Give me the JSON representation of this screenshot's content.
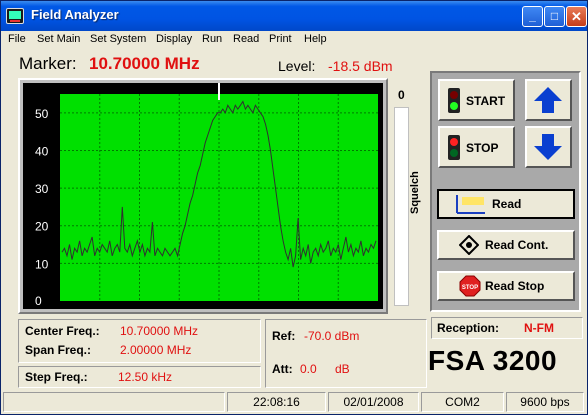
{
  "window": {
    "title": "Field Analyzer",
    "minimize": "_",
    "maximize": "□",
    "close": "✕"
  },
  "menu": [
    "File",
    "Set Main",
    "Set System",
    "Display",
    "Run",
    "Read",
    "Print",
    "Help"
  ],
  "marker": {
    "label": "Marker:",
    "value": "10.70000 MHz"
  },
  "level": {
    "label": "Level:",
    "value": "-18.5 dBm"
  },
  "graph": {
    "bg_color": "#00e000",
    "grid_color": "#007a00",
    "trace_color": "#303030",
    "y_ticks": [
      "50",
      "40",
      "30",
      "20",
      "10",
      "0"
    ],
    "y_range": [
      0,
      55
    ],
    "trace": [
      13,
      14,
      12,
      15,
      11,
      14,
      13,
      16,
      12,
      14,
      13,
      15,
      17,
      12,
      14,
      13,
      15,
      14,
      13,
      16,
      12,
      14,
      15,
      13,
      25,
      14,
      13,
      15,
      12,
      14,
      16,
      13,
      15,
      12,
      14,
      13,
      21,
      12,
      14,
      13,
      12,
      14,
      13,
      12,
      13,
      14,
      12,
      15,
      18,
      20,
      23,
      26,
      28,
      31,
      34,
      36,
      39,
      42,
      44,
      46,
      48,
      49,
      50,
      50,
      51,
      50,
      52,
      51,
      50,
      52,
      51,
      52,
      53,
      51,
      52,
      51,
      50,
      52,
      51,
      50,
      49,
      47,
      44,
      40,
      35,
      30,
      25,
      20,
      16,
      13,
      11,
      14,
      9,
      12,
      22,
      11,
      14,
      12,
      15,
      10,
      13,
      14,
      12,
      15,
      13,
      14,
      16,
      12,
      14,
      13,
      15,
      11,
      14,
      17,
      13,
      15,
      12,
      14,
      13,
      16,
      12,
      14,
      13,
      15,
      14,
      16
    ]
  },
  "squelch": {
    "value_label": "0",
    "label": "Squelch"
  },
  "controls": {
    "start": "START",
    "stop": "STOP",
    "read": "Read",
    "read_cont": "Read Cont.",
    "read_stop": "Read Stop",
    "stop_icon_text": "STOP"
  },
  "info": {
    "center_label": "Center Freq.:",
    "center_value": "10.70000 MHz",
    "span_label": "Span Freq.:",
    "span_value": "2.00000 MHz",
    "step_label": "Step Freq.:",
    "step_value": "12.50 kHz",
    "ref_label": "Ref:",
    "ref_value": "-70.0 dBm",
    "att_label": "Att:",
    "att_value": "0.0",
    "att_unit": "dB",
    "reception_label": "Reception:",
    "reception_value": "N-FM",
    "model": "FSA 3200"
  },
  "status": {
    "time": "22:08:16",
    "date": "02/01/2008",
    "port": "COM2",
    "baud": "9600 bps"
  }
}
